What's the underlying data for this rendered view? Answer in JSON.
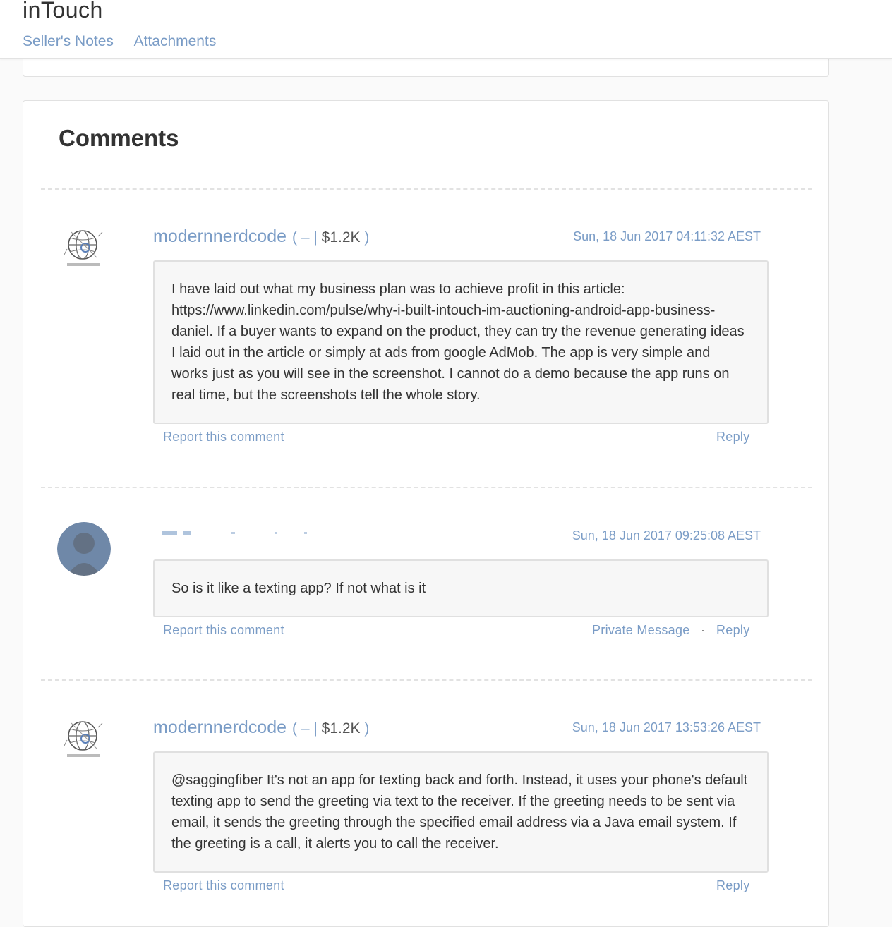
{
  "header": {
    "title": "inTouch",
    "tabs": [
      "Seller's Notes",
      "Attachments"
    ]
  },
  "comments_section": {
    "heading": "Comments",
    "comments": [
      {
        "author": "modernnerdcode",
        "author_open": "( – |",
        "author_value": "$1.2K",
        "author_close": ")",
        "timestamp": "Sun, 18 Jun 2017 04:11:32 AEST",
        "text": "I have laid out what my business plan was to achieve profit in this article: https://www.linkedin.com/pulse/why-i-built-intouch-im-auctioning-android-app-business-daniel. If a buyer wants to expand on the product, they can try the revenue generating ideas I laid out in the article or simply at ads from google AdMob. The app is very simple and works just as you will see in the screenshot. I cannot do a demo because the app runs on real time, but the screenshots tell the whole story.",
        "report": "Report this comment",
        "reply": "Reply",
        "avatar_icon": "globe-logo-icon"
      },
      {
        "timestamp": "Sun, 18 Jun 2017 09:25:08 AEST",
        "text": "So is it like a texting app? If not what is it",
        "report": "Report this comment",
        "private_message": "Private Message",
        "separator": "·",
        "reply": "Reply",
        "avatar_icon": "default-user-avatar-icon"
      },
      {
        "author": "modernnerdcode",
        "author_open": "( – |",
        "author_value": "$1.2K",
        "author_close": ")",
        "timestamp": "Sun, 18 Jun 2017 13:53:26 AEST",
        "text": "@saggingfiber It's not an app for texting back and forth. Instead, it uses your phone's default texting app to send the greeting via text to the receiver. If the greeting needs to be sent via email, it sends the greeting through the specified email address via a Java email system. If the greeting is a call, it alerts you to call the receiver.",
        "report": "Report this comment",
        "reply": "Reply",
        "avatar_icon": "globe-logo-icon"
      }
    ]
  },
  "colors": {
    "link": "#7a9cc6",
    "text": "#333333",
    "bubble_bg": "#f7f7f7",
    "page_bg": "#fafafa",
    "default_avatar": "#6f88a8"
  }
}
